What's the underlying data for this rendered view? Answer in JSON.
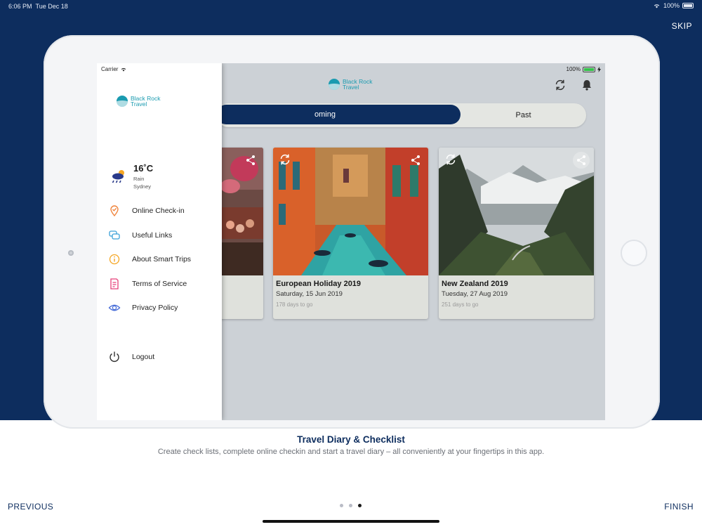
{
  "system_status": {
    "time": "6:06 PM",
    "date": "Tue Dec 18",
    "battery": "100%"
  },
  "skip_label": "SKIP",
  "screen": {
    "carrier": "Carrier",
    "battery": "100%",
    "brand": {
      "line1": "Black Rock",
      "line2": "Travel"
    },
    "tabs": {
      "active": "Upcoming",
      "active_visible": "oming",
      "inactive": "Past"
    },
    "trips": [
      {
        "title": "European Holiday 2019",
        "date": "Saturday, 15 Jun 2019",
        "days": "178 days to go"
      },
      {
        "title": "New Zealand 2019",
        "date": "Tuesday, 27 Aug 2019",
        "days": "251 days to go"
      }
    ]
  },
  "drawer": {
    "brand": {
      "line1": "Black Rock",
      "line2": "Travel"
    },
    "weather": {
      "temp": "16˚C",
      "condition": "Rain",
      "city": "Sydney"
    },
    "menu": [
      {
        "label": "Online Check-in",
        "icon": "location-check-icon",
        "color": "#f0843c"
      },
      {
        "label": "Useful Links",
        "icon": "chat-bubbles-icon",
        "color": "#3aa0d8"
      },
      {
        "label": "About Smart Trips",
        "icon": "info-icon",
        "color": "#f5a623"
      },
      {
        "label": "Terms of Service",
        "icon": "document-icon",
        "color": "#e6417a"
      },
      {
        "label": "Privacy Policy",
        "icon": "eye-icon",
        "color": "#4a6fd8"
      },
      {
        "label": "Logout",
        "icon": "power-icon",
        "color": "#333333"
      }
    ]
  },
  "onboarding": {
    "title": "Travel Diary & Checklist",
    "description": "Create check lists, complete online checkin and start a travel diary – all conveniently at your fingertips in this app.",
    "previous_label": "PREVIOUS",
    "finish_label": "FINISH",
    "page_count": 3,
    "current_page": 3
  },
  "colors": {
    "navy": "#0d2d5e",
    "teal": "#1a9bb0"
  }
}
